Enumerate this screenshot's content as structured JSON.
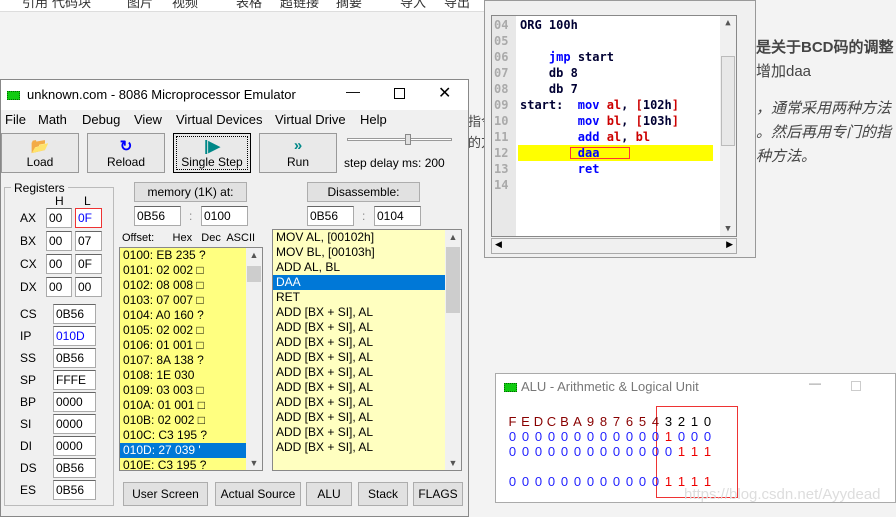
{
  "background": {
    "toolbar_items": [
      "引用",
      "代码块",
      "图片",
      "视频",
      "表格",
      "超链接",
      "摘要",
      "导入",
      "导出"
    ],
    "article_lines": [
      "是关于BCD码的调整",
      "增加daa",
      "，通常采用两种方法",
      "。然后再用专门的指",
      "种方法。"
    ],
    "left_fragments": [
      "指令",
      "的方"
    ],
    "watermark": "https://blog.csdn.net/Ayydead"
  },
  "emulator": {
    "title": "unknown.com - 8086 Microprocessor Emulator",
    "menu": [
      "File",
      "Math",
      "Debug",
      "View",
      "Virtual Devices",
      "Virtual Drive",
      "Help"
    ],
    "toolbar": {
      "load": "Load",
      "reload": "Reload",
      "single_step": "Single Step",
      "run": "Run",
      "step_delay_label": "step delay ms: 200",
      "step_delay_fraction": 0.6
    },
    "registers": {
      "title": "Registers",
      "h": "H",
      "l": "L",
      "byte_regs": [
        {
          "name": "AX",
          "h": "00",
          "l": "0F"
        },
        {
          "name": "BX",
          "h": "00",
          "l": "07"
        },
        {
          "name": "CX",
          "h": "00",
          "l": "0F"
        },
        {
          "name": "DX",
          "h": "00",
          "l": "00"
        }
      ],
      "word_regs": [
        {
          "name": "CS",
          "v": "0B56"
        },
        {
          "name": "IP",
          "v": "010D"
        },
        {
          "name": "SS",
          "v": "0B56"
        },
        {
          "name": "SP",
          "v": "FFFE"
        },
        {
          "name": "BP",
          "v": "0000"
        },
        {
          "name": "SI",
          "v": "0000"
        },
        {
          "name": "DI",
          "v": "0000"
        },
        {
          "name": "DS",
          "v": "0B56"
        },
        {
          "name": "ES",
          "v": "0B56"
        }
      ]
    },
    "memory": {
      "button": "memory (1K) at:",
      "segment": "0B56",
      "offset": "0100",
      "sep": ":",
      "header": "Offset:      Hex   Dec  ASCII",
      "rows": [
        "0100: EB 235 ?",
        "0101: 02 002 □",
        "0102: 08 008 □",
        "0103: 07 007 □",
        "0104: A0 160 ?",
        "0105: 02 002 □",
        "0106: 01 001 □",
        "0107: 8A 138 ?",
        "0108: 1E 030",
        "0109: 03 003 □",
        "010A: 01 001 □",
        "010B: 02 002 □",
        "010C: C3 195 ?",
        "010D: 27 039 '",
        "010E: C3 195 ?"
      ],
      "selected_index": 13
    },
    "disassemble": {
      "button": "Disassemble:",
      "segment": "0B56",
      "offset": "0104",
      "sep": ":",
      "rows": [
        "MOV AL, [00102h]",
        "MOV BL, [00103h]",
        "ADD AL, BL",
        "DAA",
        "RET",
        "ADD [BX + SI], AL",
        "ADD [BX + SI], AL",
        "ADD [BX + SI], AL",
        "ADD [BX + SI], AL",
        "ADD [BX + SI], AL",
        "ADD [BX + SI], AL",
        "ADD [BX + SI], AL",
        "ADD [BX + SI], AL",
        "ADD [BX + SI], AL",
        "ADD [BX + SI], AL"
      ],
      "selected_index": 3
    },
    "bottom_buttons": [
      "User Screen",
      "Actual Source",
      "ALU",
      "Stack",
      "FLAGS"
    ]
  },
  "source": {
    "lines": [
      {
        "n": "04",
        "parts": [
          [
            "d",
            "ORG 100h"
          ]
        ]
      },
      {
        "n": "05",
        "parts": []
      },
      {
        "n": "06",
        "parts": [
          [
            "",
            "    "
          ],
          [
            "k",
            "jmp"
          ],
          [
            "d",
            " start"
          ]
        ]
      },
      {
        "n": "07",
        "parts": [
          [
            "",
            "    "
          ],
          [
            "d",
            "db 8"
          ]
        ]
      },
      {
        "n": "08",
        "parts": [
          [
            "",
            "    "
          ],
          [
            "d",
            "db 7"
          ]
        ]
      },
      {
        "n": "09",
        "parts": [
          [
            "d",
            "start:  "
          ],
          [
            "k",
            "mov "
          ],
          [
            "r",
            "al"
          ],
          [
            "d",
            ", "
          ],
          [
            "r",
            "["
          ],
          [
            "d",
            "102h"
          ],
          [
            "r",
            "]"
          ]
        ]
      },
      {
        "n": "10",
        "parts": [
          [
            "",
            "        "
          ],
          [
            "k",
            "mov "
          ],
          [
            "r",
            "bl"
          ],
          [
            "d",
            ", "
          ],
          [
            "r",
            "["
          ],
          [
            "d",
            "103h"
          ],
          [
            "r",
            "]"
          ]
        ]
      },
      {
        "n": "11",
        "parts": [
          [
            "",
            "        "
          ],
          [
            "k",
            "add "
          ],
          [
            "r",
            "al"
          ],
          [
            "d",
            ", "
          ],
          [
            "r",
            "bl"
          ]
        ]
      },
      {
        "n": "12",
        "parts": [
          [
            "",
            "        "
          ],
          [
            "k",
            "daa"
          ]
        ]
      },
      {
        "n": "13",
        "parts": [
          [
            "",
            "        "
          ],
          [
            "k",
            "ret"
          ]
        ]
      },
      {
        "n": "14",
        "parts": []
      }
    ],
    "current_line_index": 8
  },
  "alu": {
    "title": "ALU - Arithmetic & Logical Unit",
    "bit_labels": [
      "F",
      "E",
      "D",
      "C",
      "B",
      "A",
      "9",
      "8",
      "7",
      "6",
      "5",
      "4",
      "3",
      "2",
      "1",
      "0"
    ],
    "rows": [
      [
        "0",
        "0",
        "0",
        "0",
        "0",
        "0",
        "0",
        "0",
        "0",
        "0",
        "0",
        "0",
        "1",
        "0",
        "0",
        "0"
      ],
      [
        "0",
        "0",
        "0",
        "0",
        "0",
        "0",
        "0",
        "0",
        "0",
        "0",
        "0",
        "0",
        "0",
        "1",
        "1",
        "1"
      ],
      [
        "0",
        "0",
        "0",
        "0",
        "0",
        "0",
        "0",
        "0",
        "0",
        "0",
        "0",
        "0",
        "1",
        "1",
        "1",
        "1"
      ]
    ]
  }
}
